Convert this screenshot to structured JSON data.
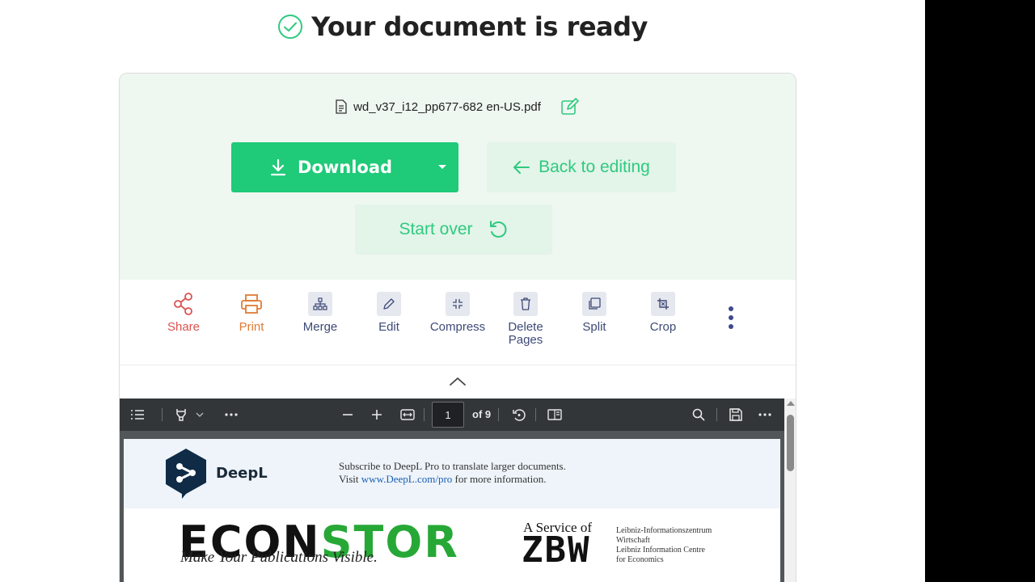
{
  "header": {
    "title": "Your document is ready"
  },
  "file": {
    "name": "wd_v37_i12_pp677-682 en-US.pdf"
  },
  "actions": {
    "download_label": "Download",
    "back_label": "Back to editing",
    "start_over_label": "Start over"
  },
  "tools": [
    {
      "label": "Share",
      "icon": "share-icon"
    },
    {
      "label": "Print",
      "icon": "printer-icon"
    },
    {
      "label": "Merge",
      "icon": "merge-icon"
    },
    {
      "label": "Edit",
      "icon": "pencil-icon"
    },
    {
      "label": "Compress",
      "icon": "compress-icon"
    },
    {
      "label": "Delete Pages",
      "icon": "trash-icon"
    },
    {
      "label": "Split",
      "icon": "split-icon"
    },
    {
      "label": "Crop",
      "icon": "crop-icon"
    }
  ],
  "viewer": {
    "current_page": "1",
    "total_pages": "of 9"
  },
  "pdf_page": {
    "deepl_name": "DeepL",
    "deepl_line1": "Subscribe to DeepL Pro to translate larger documents.",
    "deepl_line2_prefix": "Visit ",
    "deepl_link": "www.DeepL.com/pro",
    "deepl_line2_suffix": " for more information.",
    "econstor_black": "ECON",
    "econstor_green": "STOR",
    "econstor_tagline": "Make Your Publications Visible.",
    "service_text": "A Service of",
    "zbw": "ZBW",
    "leibniz_lines": [
      "Leibniz-Informationszentrum",
      "Wirtschaft",
      "Leibniz Information Centre",
      "for Economics"
    ]
  },
  "colors": {
    "accent": "#1fca78",
    "accent_light": "#e3f4e9",
    "card_bg": "#eff7f1",
    "share": "#d9534f",
    "print": "#e07b35",
    "tool_text": "#3e4a77"
  }
}
